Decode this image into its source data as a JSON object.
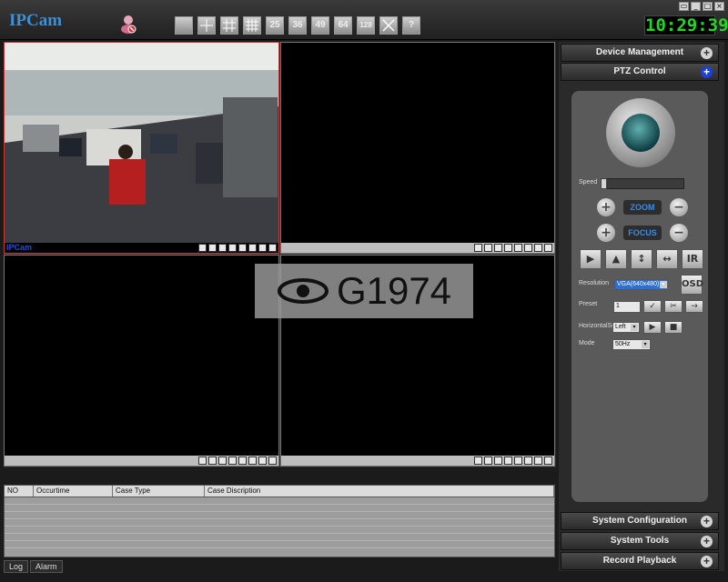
{
  "app": {
    "logo": "IPCam",
    "clock": "10:29:39"
  },
  "toolbar": {
    "layouts": [
      {
        "name": "layout-1-button",
        "label": ""
      },
      {
        "name": "layout-4-button",
        "label": ""
      },
      {
        "name": "layout-9-button",
        "label": ""
      },
      {
        "name": "layout-16-button",
        "label": ""
      },
      {
        "name": "layout-25-button",
        "label": "25"
      },
      {
        "name": "layout-36-button",
        "label": "36"
      },
      {
        "name": "layout-49-button",
        "label": "49"
      },
      {
        "name": "layout-64-button",
        "label": "64"
      },
      {
        "name": "layout-128-button",
        "label": "128"
      },
      {
        "name": "fullscreen-button",
        "label": ""
      },
      {
        "name": "help-button",
        "label": "?"
      }
    ]
  },
  "grid": {
    "active_cell_label": "IPCam"
  },
  "watermark": "G1974",
  "log": {
    "columns": [
      "NO",
      "Occurtime",
      "Case Type",
      "Case Discription"
    ],
    "tabs": [
      "Log",
      "Alarm"
    ]
  },
  "panel": {
    "device_management": "Device Management",
    "ptz_control": "PTZ Control",
    "speed_label": "Speed",
    "zoom_label": "ZOOM",
    "focus_label": "FOCUS",
    "ir_label": "IR",
    "osd_label": "OSD",
    "resolution_label": "Resolution",
    "resolution_value": "VGA(640x480)",
    "preset_label": "Preset",
    "preset_value": "1",
    "horizontal_label": "HorizontalSc",
    "horizontal_value": "Left",
    "mode_label": "Mode",
    "mode_value": "50Hz",
    "system_configuration": "System Configuration",
    "system_tools": "System Tools",
    "record_playback": "Record Playback"
  },
  "colors": {
    "clock": "#27d427",
    "logo": "#3d8fd6",
    "active_border": "#c63a3a",
    "ptz_plus": "#1c3fd6"
  }
}
